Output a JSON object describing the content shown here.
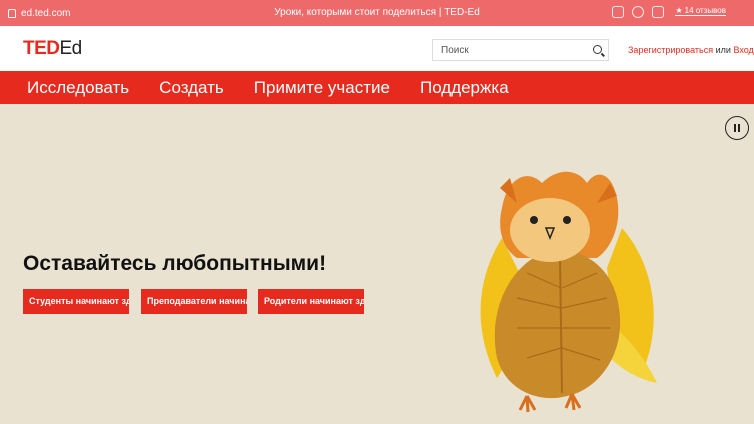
{
  "browser": {
    "url": "ed.ted.com",
    "tab_title": "Уроки, которыми стоит поделиться | TED-Ed",
    "reviews_label": "14 отзывов"
  },
  "header": {
    "logo_ted": "TED",
    "logo_ed": "Ed",
    "search_placeholder": "Поиск",
    "register_link": "Зарегистрироваться",
    "or_text": "или",
    "login_link": "Вход"
  },
  "nav": {
    "items": [
      {
        "label": "Исследовать"
      },
      {
        "label": "Создать"
      },
      {
        "label": "Примите участие"
      },
      {
        "label": "Поддержка"
      }
    ]
  },
  "hero": {
    "headline": "Оставайтесь любопытными!",
    "buttons": [
      {
        "label": "Студенты начинают здесь"
      },
      {
        "label": "Преподаватели начинают здесь"
      },
      {
        "label": "Родители начинают здесь"
      }
    ],
    "image_icon": "leaf-owl-illustration"
  },
  "colors": {
    "brand_red": "#e62b1e",
    "hero_bg": "#e9e2d0",
    "chrome_bg": "#ee6a6a"
  }
}
